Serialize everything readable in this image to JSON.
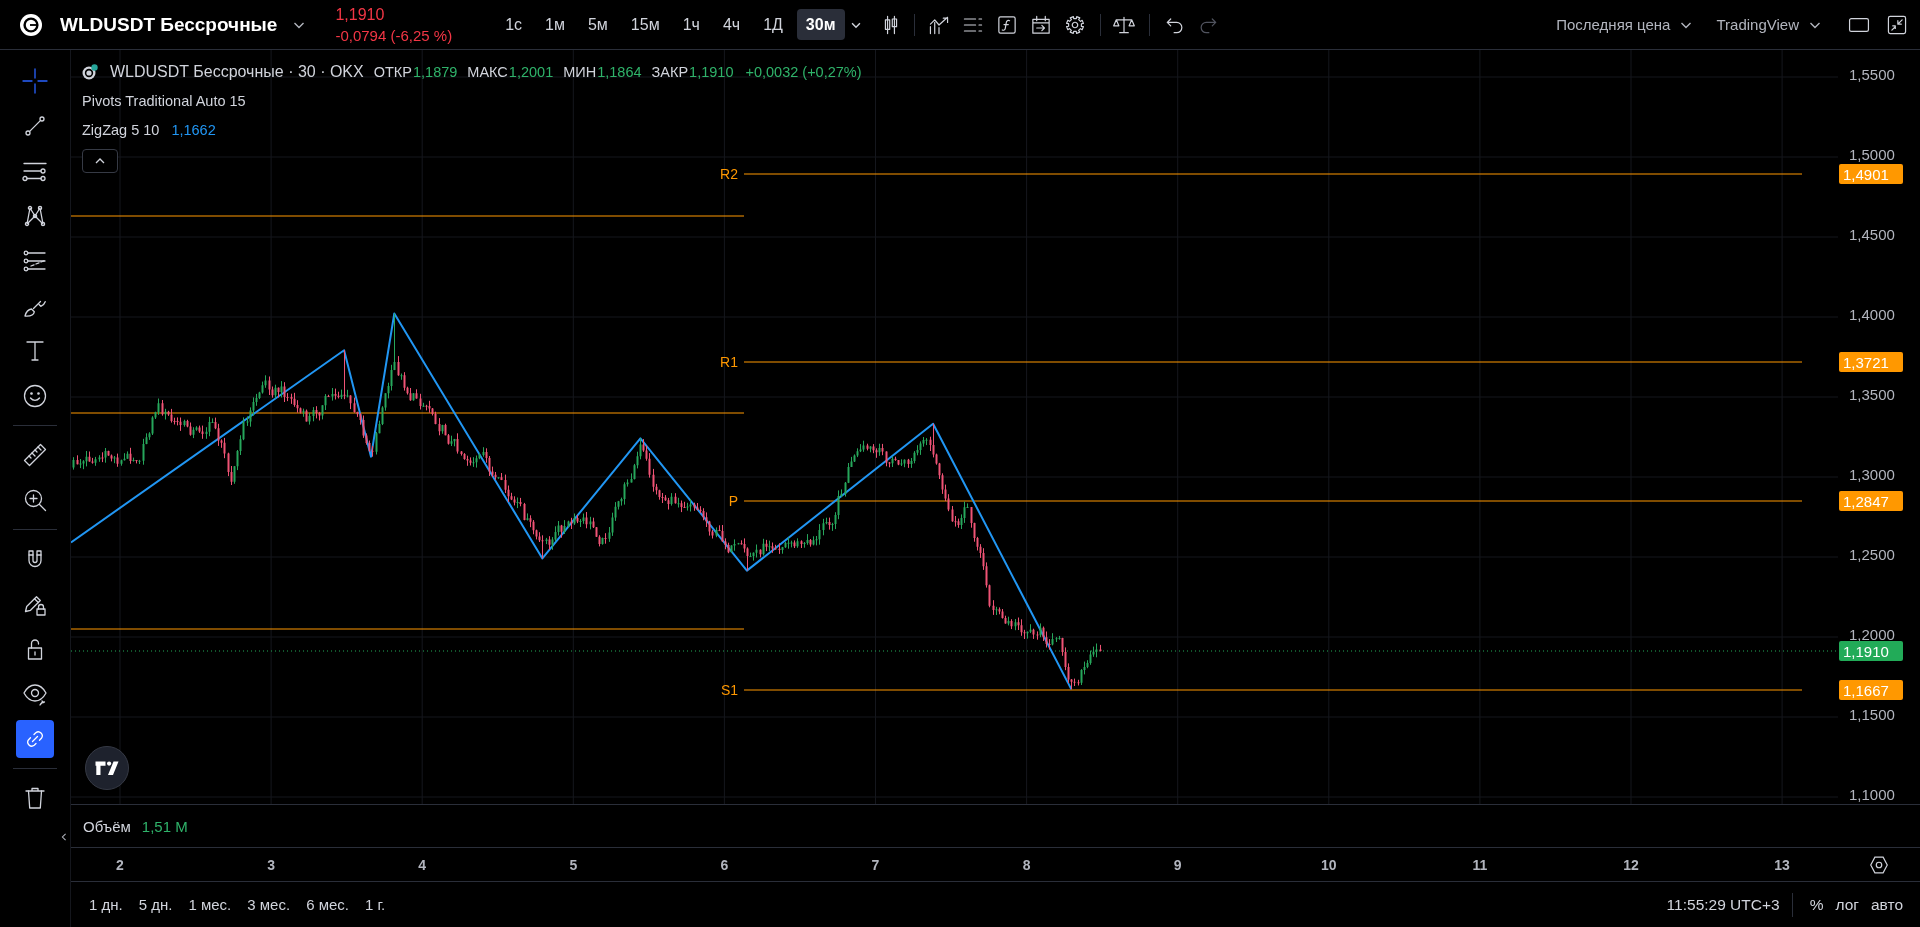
{
  "header": {
    "symbol": "WLDUSDT Бессрочные",
    "last_price": "1,1910",
    "change": "-0,0794 (-6,25 %)",
    "intervals": [
      {
        "label": "1с",
        "selected": false
      },
      {
        "label": "1м",
        "selected": false
      },
      {
        "label": "5м",
        "selected": false
      },
      {
        "label": "15м",
        "selected": false
      },
      {
        "label": "1ч",
        "selected": false
      },
      {
        "label": "4ч",
        "selected": false
      },
      {
        "label": "1Д",
        "selected": false
      },
      {
        "label": "30м",
        "selected": true
      }
    ],
    "undo": {
      "disabled": false
    },
    "redo": {
      "disabled": true
    },
    "price_source": "Последняя цена",
    "layout": "TradingView"
  },
  "toolbar": {
    "groups": [
      {
        "tools": [
          {
            "kind": "crosshair",
            "selected": true
          },
          {
            "kind": "line",
            "selected": false
          },
          {
            "kind": "fib",
            "selected": false
          },
          {
            "kind": "pattern",
            "selected": false
          },
          {
            "kind": "forecast",
            "selected": false
          },
          {
            "kind": "brush",
            "selected": false
          },
          {
            "kind": "text",
            "selected": false
          },
          {
            "kind": "emoji",
            "selected": false
          }
        ]
      },
      {
        "tools": [
          {
            "kind": "ruler",
            "selected": false
          },
          {
            "kind": "zoom",
            "selected": false
          }
        ]
      },
      {
        "tools": [
          {
            "kind": "magnet",
            "on": false
          },
          {
            "kind": "drawlock",
            "on": false
          },
          {
            "kind": "lock",
            "on": false
          },
          {
            "kind": "eye",
            "on": false
          },
          {
            "kind": "link",
            "on": true
          }
        ]
      },
      {
        "tools": [
          {
            "kind": "trash"
          }
        ]
      }
    ]
  },
  "legend": {
    "title": "WLDUSDT Бессрочные · 30 · OKX",
    "ohlc": [
      {
        "label": "ОТКР",
        "value": "1,1879"
      },
      {
        "label": "МАКС",
        "value": "1,2001"
      },
      {
        "label": "МИН",
        "value": "1,1864"
      },
      {
        "label": "ЗАКР",
        "value": "1,1910"
      }
    ],
    "change": "+0,0032 (+0,27%)",
    "expanded": true,
    "indicators": [
      {
        "name": "Pivots Traditional Auto 15"
      },
      {
        "name": "ZigZag 5 10",
        "value": "1,1662",
        "color": "#2196f3"
      }
    ]
  },
  "chart": {
    "pivots": [
      {
        "label": "R2",
        "tag": "1,4901"
      },
      {
        "label": "R1",
        "tag": "1,3721"
      },
      {
        "label": "P",
        "tag": "1,2847"
      },
      {
        "label": "S1",
        "tag": "1,1667"
      }
    ],
    "current_price_tag": "1,1910",
    "price_axis": [
      "1,5500",
      "1,5000",
      "1,4500",
      "1,4000",
      "1,3500",
      "1,3000",
      "1,2500",
      "1,2000",
      "1,1500",
      "1,1000"
    ],
    "time_axis": [
      "2",
      "3",
      "4",
      "5",
      "6",
      "7",
      "8",
      "9",
      "10",
      "11",
      "12",
      "13"
    ]
  },
  "volume_pane": {
    "label": "Объём",
    "value": "1,51 M"
  },
  "bottom_bar": {
    "ranges": [
      "1 дн.",
      "5 дн.",
      "1 мес.",
      "3 мес.",
      "6 мес.",
      "1 г."
    ],
    "clock": "11:55:29 UTC+3",
    "scale_buttons": [
      "%",
      "лог",
      "авто"
    ]
  }
}
